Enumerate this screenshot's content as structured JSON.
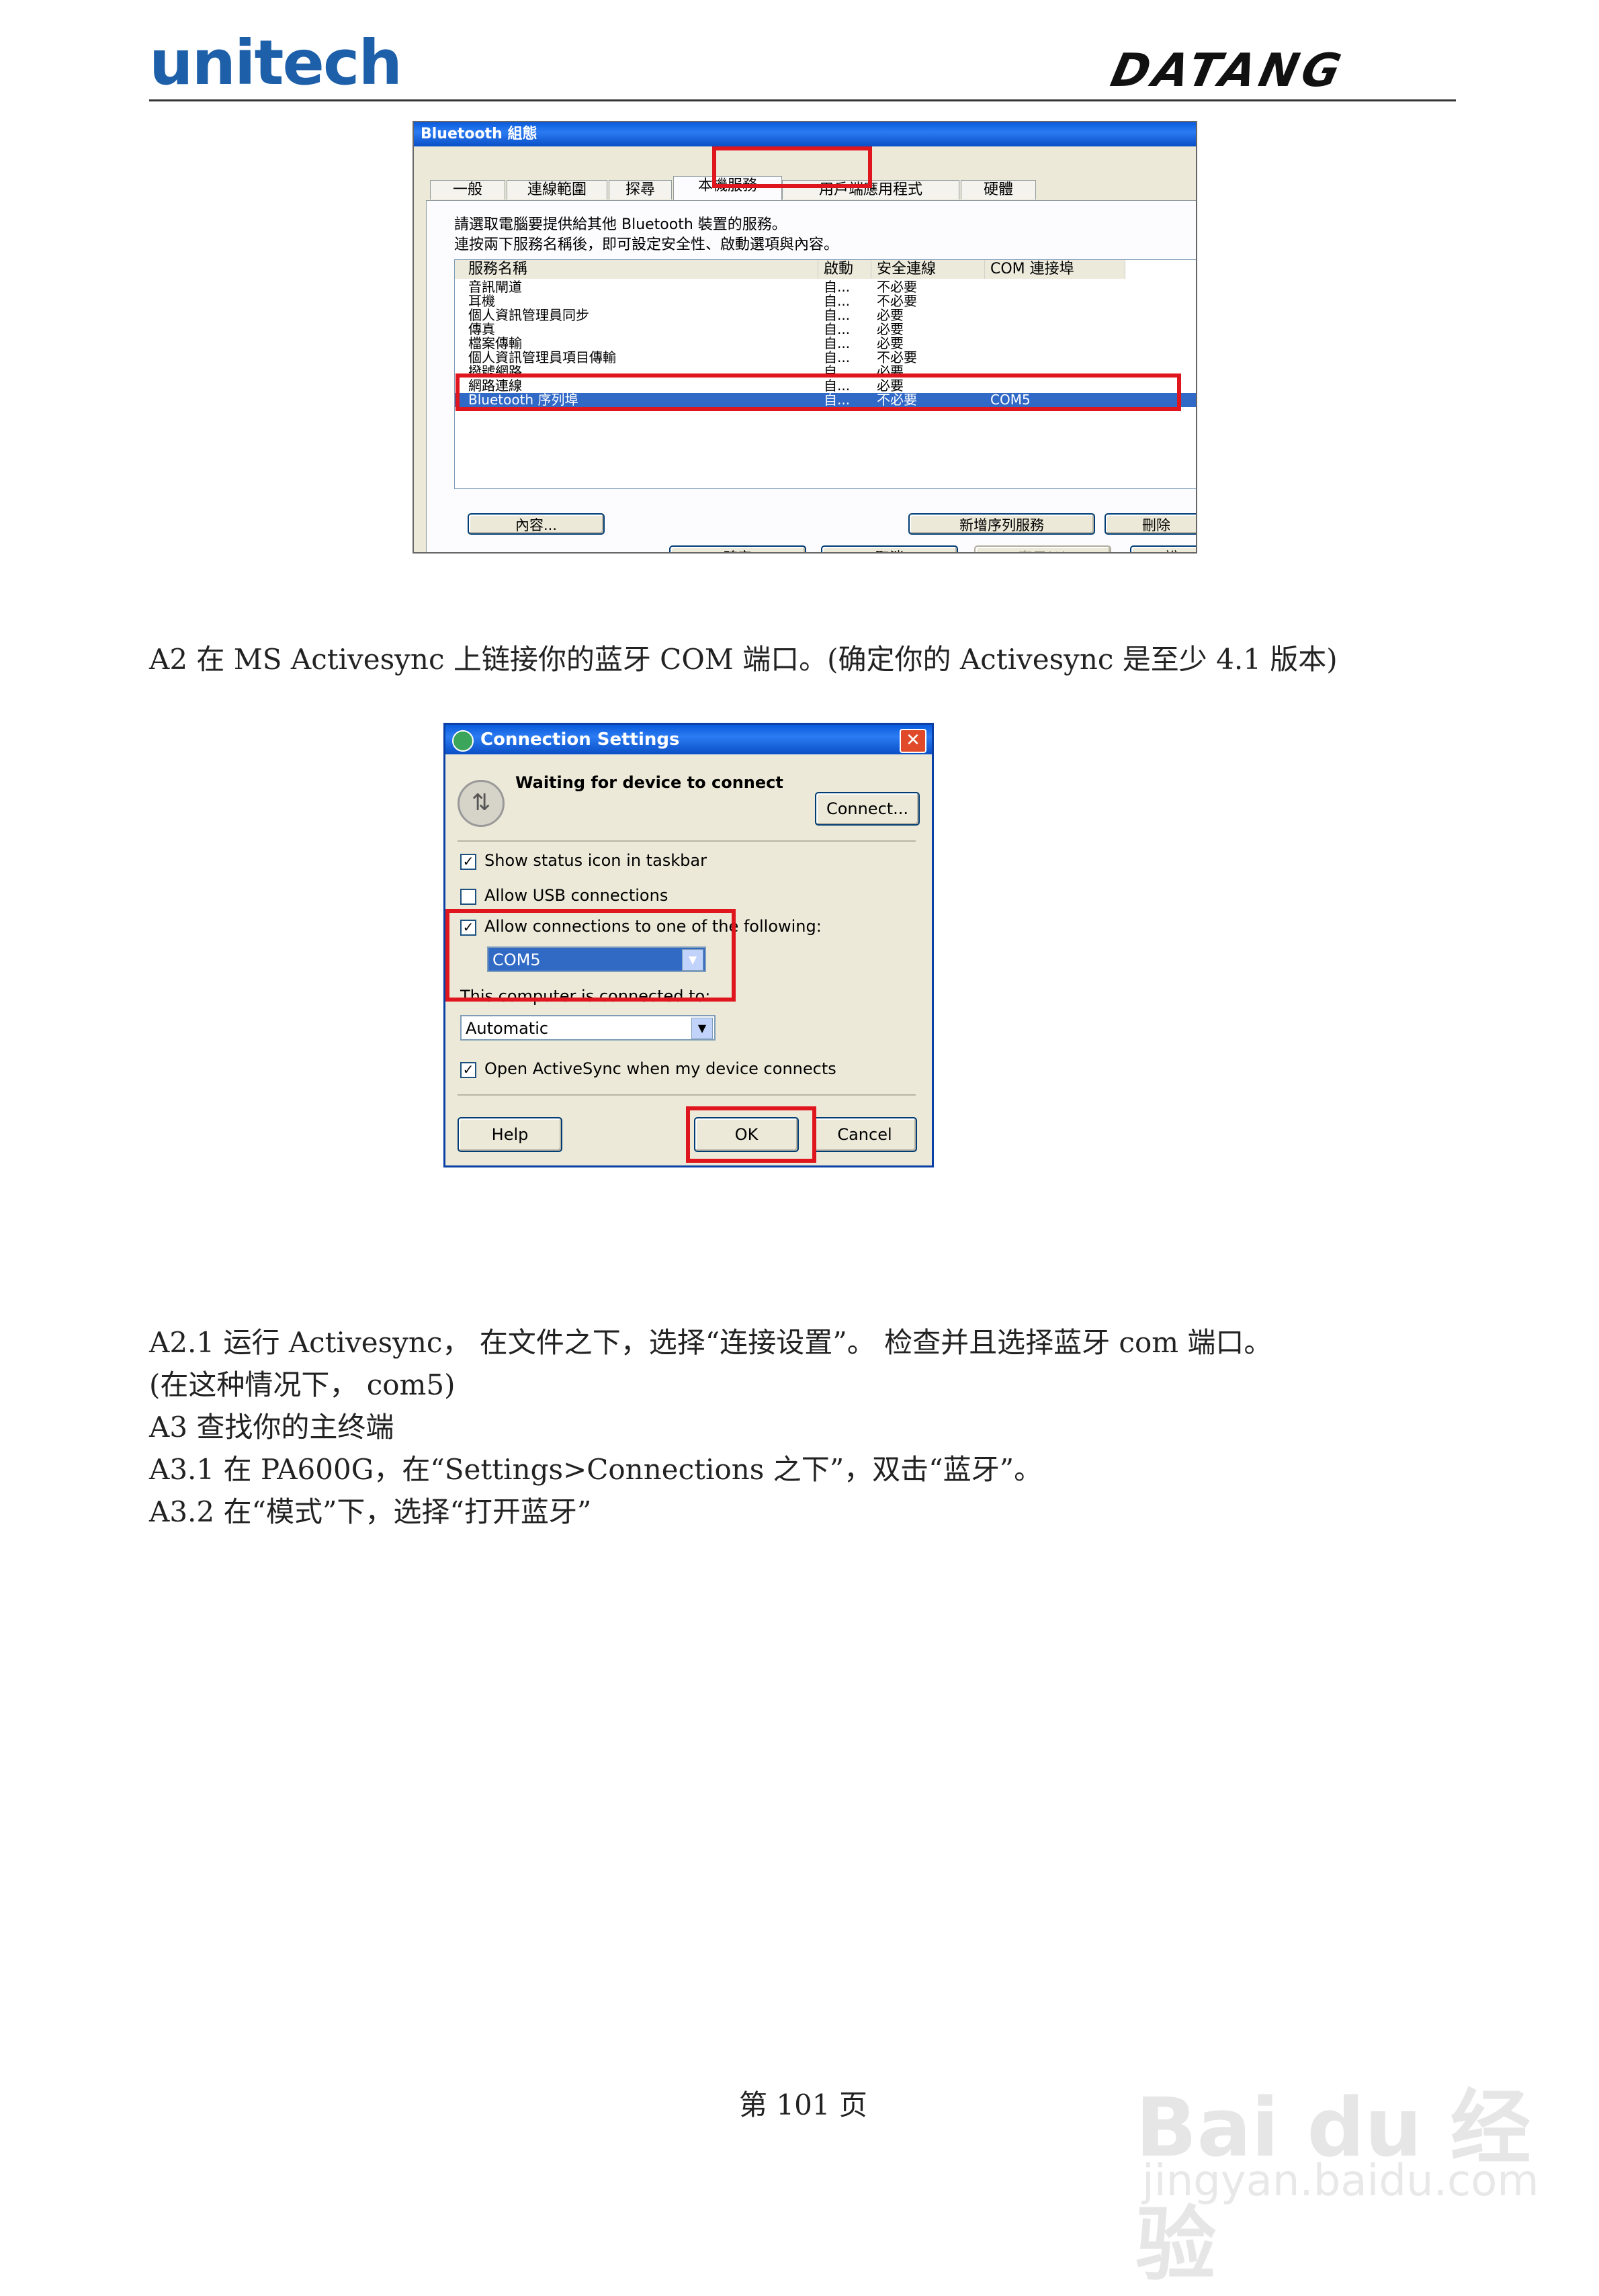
{
  "header": {
    "logo_left": "unitech",
    "logo_right": "DATANG"
  },
  "bt_window": {
    "title": "Bluetooth 組態",
    "tabs": [
      "一般",
      "連線範圍",
      "探尋",
      "本機服務",
      "用戶端應用程式",
      "硬體"
    ],
    "desc_line1": "請選取電腦要提供給其他 Bluetooth 裝置的服務。",
    "desc_line2": "連按兩下服務名稱後，即可設定安全性、啟動選項與內容。",
    "columns": [
      "服務名稱",
      "啟動",
      "安全連線",
      "COM 連接埠"
    ],
    "rows": [
      {
        "name": "音訊閘道",
        "start": "自...",
        "secure": "不必要",
        "com": ""
      },
      {
        "name": "耳機",
        "start": "自...",
        "secure": "不必要",
        "com": ""
      },
      {
        "name": "個人資訊管理員同步",
        "start": "自...",
        "secure": "必要",
        "com": ""
      },
      {
        "name": "傳真",
        "start": "自...",
        "secure": "必要",
        "com": ""
      },
      {
        "name": "檔案傳輸",
        "start": "自...",
        "secure": "必要",
        "com": ""
      },
      {
        "name": "個人資訊管理員項目傳輸",
        "start": "自...",
        "secure": "不必要",
        "com": ""
      },
      {
        "name": "撥號網路",
        "start": "自...",
        "secure": "必要",
        "com": ""
      },
      {
        "name": "網路連線",
        "start": "自...",
        "secure": "必要",
        "com": ""
      },
      {
        "name": "Bluetooth 序列埠",
        "start": "自...",
        "secure": "不必要",
        "com": "COM5"
      }
    ],
    "btn_properties": "內容...",
    "btn_add_serial": "新增序列服務",
    "btn_delete": "刪除",
    "btn_ok": "確定",
    "btn_cancel": "取消",
    "btn_apply": "套用(A)",
    "btn_cut": "說"
  },
  "para_a2": "A2 在 MS Activesync 上链接你的蓝牙 COM 端口。(确定你的 Activesync 是至少 4.1 版本)",
  "cs_window": {
    "title": "Connection Settings",
    "status": "Waiting for device to connect",
    "connect_btn": "Connect...",
    "opt_status_icon": "Show status icon in taskbar",
    "opt_usb": "Allow USB connections",
    "opt_allow_conn": "Allow connections to one of the following:",
    "com_value": "COM5",
    "connected_to_label": "This computer is connected to:",
    "connected_to_value": "Automatic",
    "opt_open_activesync": "Open ActiveSync when my device connects",
    "help_btn": "Help",
    "ok_btn": "OK",
    "cancel_btn": "Cancel"
  },
  "body": {
    "line1": "A2.1 运行 Activesync，  在文件之下，选择“连接设置”。 检查并且选择蓝牙 com 端口。",
    "line2": "(在这种情况下，  com5)",
    "line3": "A3 查找你的主终端",
    "line4": "A3.1 在 PA600G，在“Settings>Connections 之下”，双击“蓝牙”。",
    "line5": "A3.2  在“模式”下，选择“打开蓝牙”"
  },
  "footer": {
    "page": "第 101 页"
  },
  "watermark": {
    "brand": "Bai du 经验",
    "url": "jingyan.baidu.com"
  }
}
